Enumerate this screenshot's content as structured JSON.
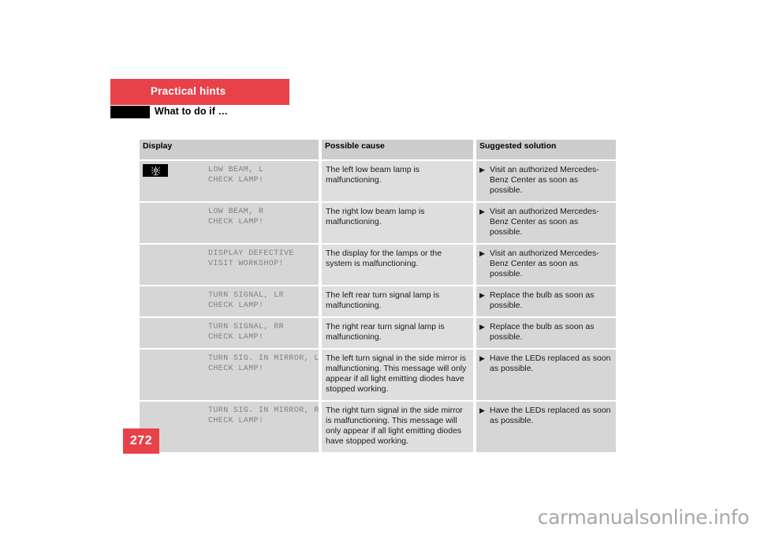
{
  "header": {
    "chapter_label": "Practical hints",
    "section_title": "What to do if …",
    "chapter_bar_color": "#e8414a",
    "section_block_color": "#000000"
  },
  "table": {
    "columns": [
      "Display",
      "Possible cause",
      "Suggested solution"
    ],
    "bullet_glyph": "▶",
    "rows": [
      {
        "icon": "lamp-defect-icon",
        "display_line1": "LOW BEAM, L",
        "display_line2": "CHECK LAMP!",
        "cause": "The left low beam lamp is malfunctioning.",
        "solution": "Visit an authorized Mercedes-Benz Center as soon as possible."
      },
      {
        "icon": null,
        "display_line1": "LOW BEAM, R",
        "display_line2": "CHECK LAMP!",
        "cause": "The right low beam lamp is malfunctioning.",
        "solution": "Visit an authorized Mercedes-Benz Center as soon as possible."
      },
      {
        "icon": null,
        "display_line1": "DISPLAY DEFECTIVE",
        "display_line2": "VISIT WORKSHOP!",
        "cause": "The display for the lamps or the system is malfunctioning.",
        "solution": "Visit an authorized Mercedes-Benz Center as soon as possible."
      },
      {
        "icon": null,
        "display_line1": "TURN SIGNAL, LR",
        "display_line2": "CHECK LAMP!",
        "cause": "The left rear turn signal lamp is malfunctioning.",
        "solution": "Replace the bulb as soon as possible."
      },
      {
        "icon": null,
        "display_line1": "TURN SIGNAL, RR",
        "display_line2": "CHECK LAMP!",
        "cause": "The right rear turn signal lamp is malfunctioning.",
        "solution": "Replace the bulb as soon as possible."
      },
      {
        "icon": null,
        "display_line1": "TURN SIG. IN MIRROR, L",
        "display_line2": "CHECK LAMP!",
        "cause": "The left turn signal in the side mirror is malfunctioning. This message will only appear if all light emitting diodes have stopped working.",
        "solution": "Have the LEDs replaced as soon as possible."
      },
      {
        "icon": null,
        "display_line1": "TURN SIG. IN MIRROR, R",
        "display_line2": "CHECK LAMP!",
        "cause": "The right turn signal in the side mirror is malfunctioning. This message will only appear if all light emitting diodes have stopped working.",
        "solution": "Have the LEDs replaced as soon as possible."
      }
    ]
  },
  "footer": {
    "page_number": "272",
    "page_number_color": "#e8414a",
    "watermark": "carmanualsonline.info"
  }
}
